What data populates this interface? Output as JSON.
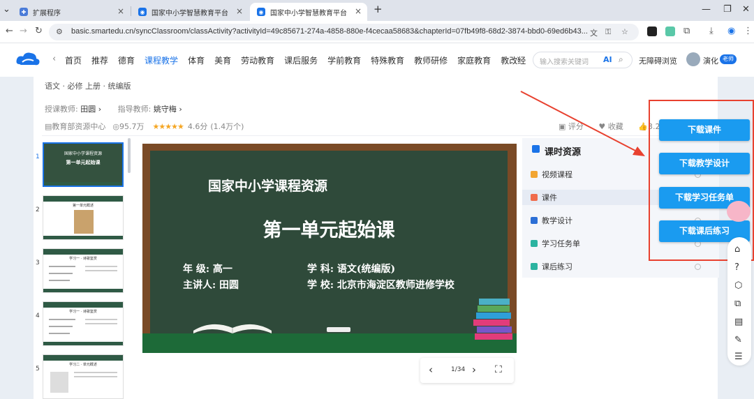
{
  "browser": {
    "tabs": [
      {
        "title": "扩展程序"
      },
      {
        "title": "国家中小学智慧教育平台"
      },
      {
        "title": "国家中小学智慧教育平台"
      }
    ],
    "new_tab": "+",
    "url": "basic.smartedu.cn/syncClassroom/classActivity?activityId=49c85671-274a-4858-880e-f4cecaa58683&chapterId=07fb49f8-68d2-3874-bbd0-69ed6b43..."
  },
  "header": {
    "menu": [
      "首页",
      "推荐",
      "德育",
      "课程教学",
      "体育",
      "美育",
      "劳动教育",
      "课后服务",
      "学前教育",
      "特殊教育",
      "教师研修",
      "家庭教育",
      "教改经"
    ],
    "active_menu": "课程教学",
    "search_placeholder": "输入搜索关键词",
    "ai_label": "AI",
    "accessibility": "无障碍浏览",
    "user_name": "演化",
    "user_badge": "老师"
  },
  "lesson": {
    "breadcrumb": "语文 · 必修 上册 · 统编版",
    "teacher_label": "授课教师:",
    "teacher": "田圆",
    "advisor_label": "指导教师:",
    "advisor": "姚守梅",
    "publisher": "教育部资源中心",
    "views": "95.7万",
    "rating": "4.6分",
    "rating_count": "(1.4万个)",
    "actions": [
      "评分",
      "收藏",
      "3.2"
    ]
  },
  "thumbnails": {
    "numbers": [
      "1",
      "2",
      "3",
      "4",
      "5"
    ],
    "first_title": "国家中小学课程资源",
    "first_subtitle": "第一单元起始课",
    "second_label": "第一单元概述",
    "third_label": "学习一 · 诗歌鉴赏",
    "fourth_label": "学习一 · 诗歌鉴赏",
    "fifth_label": "学习二 · 单元概述"
  },
  "slide": {
    "heading": "国家中小学课程资源",
    "title": "第一单元起始课",
    "grade": "年  级: 高一",
    "subject": "学  科: 语文(统编版)",
    "speaker": "主讲人: 田圆",
    "school": "学  校: 北京市海淀区教师进修学校",
    "page": "1/34"
  },
  "resources": {
    "header": "课时资源",
    "items": [
      "视频课程",
      "课件",
      "教学设计",
      "学习任务单",
      "课后练习"
    ],
    "selected": "课件"
  },
  "downloads": [
    "下载课件",
    "下载教学设计",
    "下载学习任务单",
    "下载课后练习"
  ],
  "colors": {
    "accent": "#1a73e8",
    "download_button": "#1a9bf0",
    "annotation_red": "#e8412f",
    "chalkboard": "#2f4a3a"
  }
}
